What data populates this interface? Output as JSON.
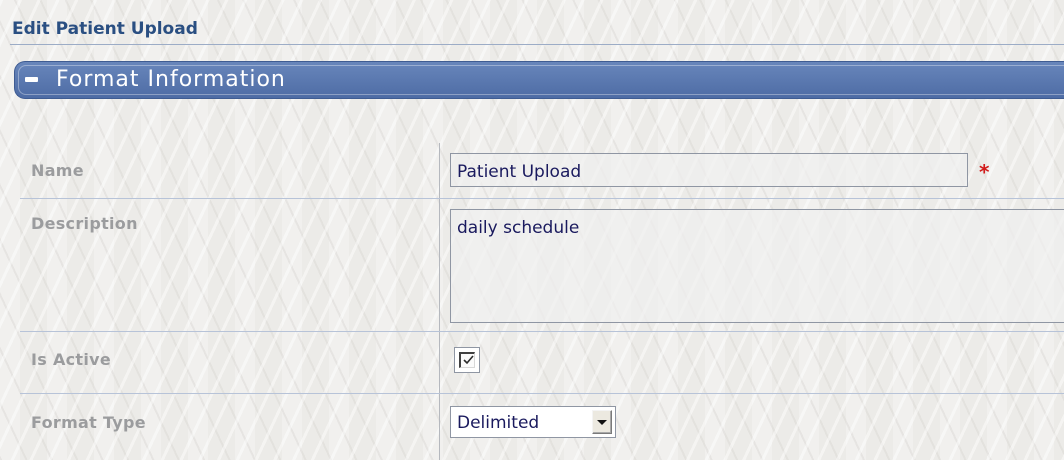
{
  "page": {
    "title": "Edit Patient Upload"
  },
  "section": {
    "title": "Format Information",
    "collapse_icon": "minus-icon"
  },
  "form": {
    "name": {
      "label": "Name",
      "value": "Patient Upload",
      "required_marker": "*"
    },
    "description": {
      "label": "Description",
      "value": "daily schedule"
    },
    "is_active": {
      "label": "Is Active",
      "checked": true,
      "icon": "checkmark-icon"
    },
    "format_type": {
      "label": "Format Type",
      "selected": "Delimited",
      "arrow_icon": "chevron-down-icon"
    }
  },
  "colors": {
    "title_text": "#2a4f82",
    "section_header": "#5574ad",
    "label_text": "#9b9c9e",
    "input_text": "#1a1a5e",
    "required": "#d11a1a"
  }
}
